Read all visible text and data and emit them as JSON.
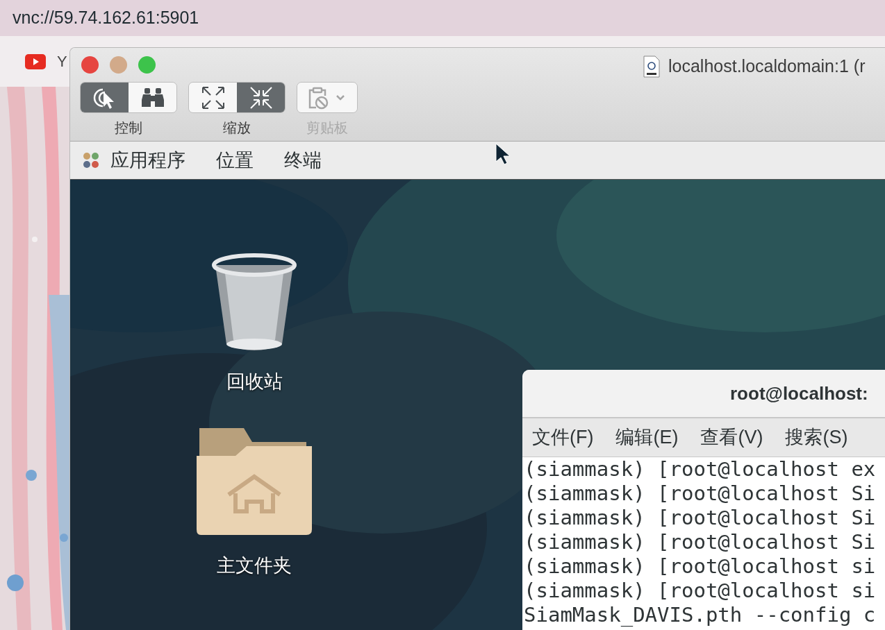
{
  "browser": {
    "address": "vnc://59.74.162.61:5901",
    "bookmarks": [
      {
        "label": "Y"
      }
    ]
  },
  "vnc_window": {
    "title": "localhost.localdomain:1 (r",
    "toolbar": [
      {
        "label": "控制",
        "disabled": false,
        "buttons": [
          {
            "kind": "control",
            "selected": true
          },
          {
            "kind": "binoculars",
            "selected": false
          }
        ]
      },
      {
        "label": "缩放",
        "disabled": false,
        "buttons": [
          {
            "kind": "expand",
            "selected": false
          },
          {
            "kind": "shrink",
            "selected": true
          }
        ]
      },
      {
        "label": "剪贴板",
        "disabled": true,
        "buttons": [
          {
            "kind": "clipboard",
            "selected": false
          }
        ]
      }
    ]
  },
  "top_bar": {
    "menus": [
      "应用程序",
      "位置",
      "终端"
    ]
  },
  "desktop_icons": [
    {
      "kind": "trash",
      "label": "回收站"
    },
    {
      "kind": "home-folder",
      "label": "主文件夹"
    }
  ],
  "terminal": {
    "title": "root@localhost:",
    "menu": [
      "文件(F)",
      "编辑(E)",
      "查看(V)",
      "搜索(S)"
    ],
    "lines": [
      "(siammask) [root@localhost ex",
      "(siammask) [root@localhost Si",
      "(siammask) [root@localhost Si",
      "(siammask) [root@localhost Si",
      "(siammask) [root@localhost si",
      "(siammask) [root@localhost si",
      "SiamMask_DAVIS.pth --config c"
    ]
  }
}
